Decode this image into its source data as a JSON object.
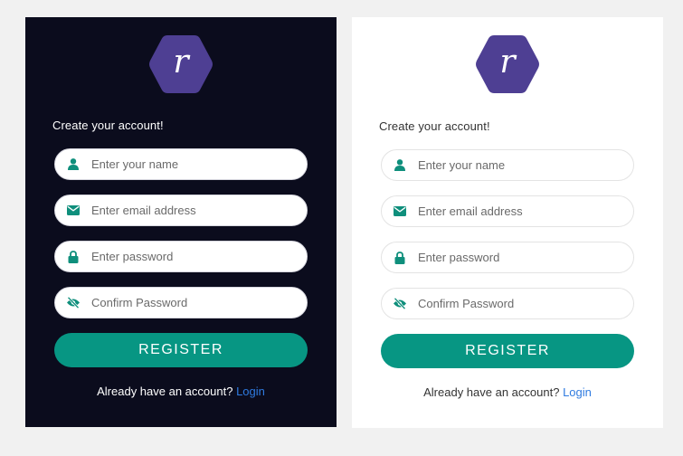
{
  "colors": {
    "page_bg": "#f1f1f1",
    "dark_card_bg": "#0b0c1d",
    "light_card_bg": "#ffffff",
    "brand_purple": "#4e3f93",
    "accent_teal": "#079683",
    "link_blue": "#2f7be0"
  },
  "cards": [
    {
      "theme": "dark",
      "logo_letter": "r",
      "heading": "Create your account!",
      "fields": [
        {
          "icon": "user-icon",
          "placeholder": "Enter your name",
          "type": "text"
        },
        {
          "icon": "envelope-icon",
          "placeholder": "Enter email address",
          "type": "email"
        },
        {
          "icon": "lock-icon",
          "placeholder": "Enter password",
          "type": "password"
        },
        {
          "icon": "eye-slash-icon",
          "placeholder": "Confirm Password",
          "type": "password"
        }
      ],
      "register_label": "REGISTER",
      "login_prompt": "Already have an account?",
      "login_link": "Login"
    },
    {
      "theme": "light",
      "logo_letter": "r",
      "heading": "Create your account!",
      "fields": [
        {
          "icon": "user-icon",
          "placeholder": "Enter your name",
          "type": "text"
        },
        {
          "icon": "envelope-icon",
          "placeholder": "Enter email address",
          "type": "email"
        },
        {
          "icon": "lock-icon",
          "placeholder": "Enter password",
          "type": "password"
        },
        {
          "icon": "eye-slash-icon",
          "placeholder": "Confirm Password",
          "type": "password"
        }
      ],
      "register_label": "REGISTER",
      "login_prompt": "Already have an account?",
      "login_link": "Login"
    }
  ]
}
